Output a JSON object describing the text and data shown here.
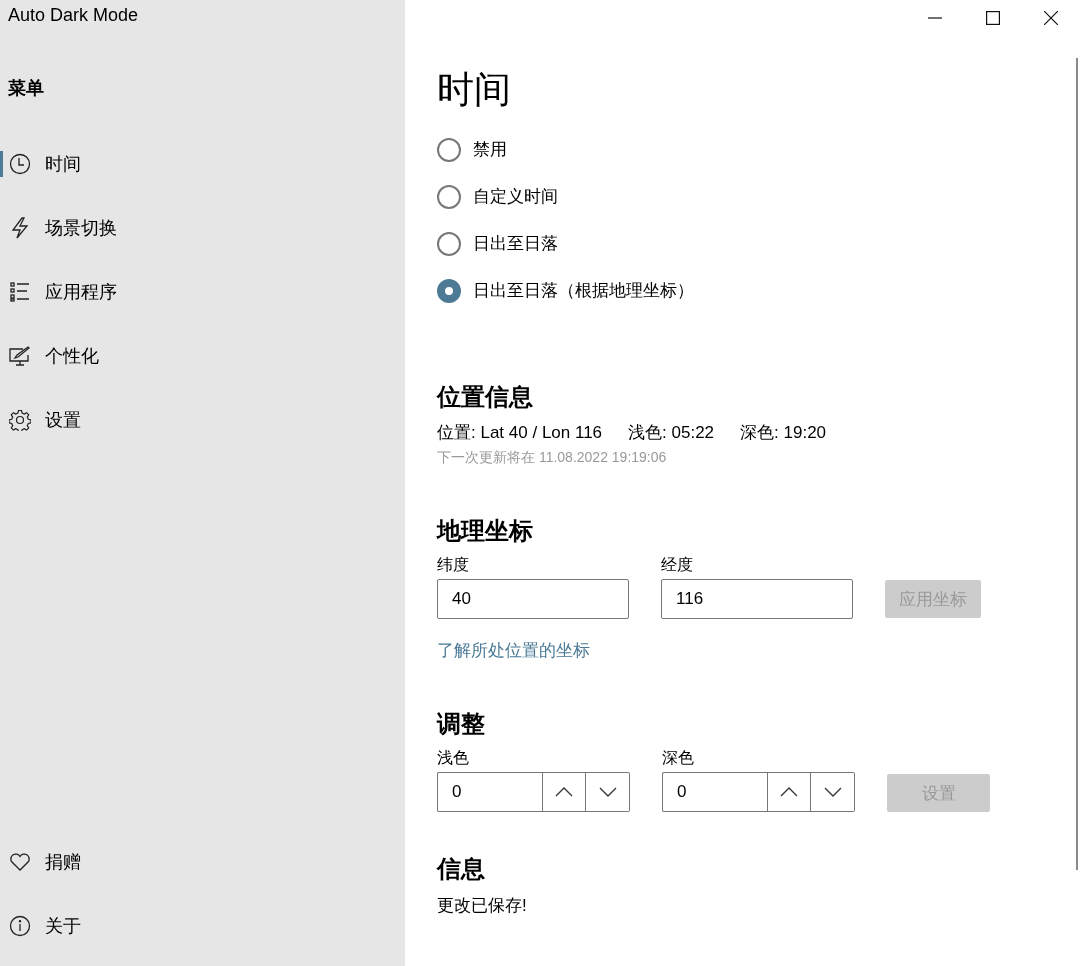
{
  "window": {
    "title": "Auto Dark Mode"
  },
  "sidebar": {
    "heading": "菜单",
    "items": [
      {
        "label": "时间",
        "selected": true
      },
      {
        "label": "场景切换",
        "selected": false
      },
      {
        "label": "应用程序",
        "selected": false
      },
      {
        "label": "个性化",
        "selected": false
      },
      {
        "label": "设置",
        "selected": false
      }
    ],
    "footer_items": [
      {
        "label": "捐赠",
        "selected": false
      },
      {
        "label": "关于",
        "selected": false
      }
    ]
  },
  "page": {
    "title": "时间",
    "radios": [
      {
        "label": "禁用",
        "selected": false
      },
      {
        "label": "自定义时间",
        "selected": false
      },
      {
        "label": "日出至日落",
        "selected": false
      },
      {
        "label": "日出至日落（根据地理坐标）",
        "selected": true
      }
    ],
    "location": {
      "heading": "位置信息",
      "position": "位置: Lat 40 / Lon 116",
      "light": "浅色: 05:22",
      "dark": "深色: 19:20",
      "next_update": "下一次更新将在 11.08.2022 19:19:06"
    },
    "coordinates": {
      "heading": "地理坐标",
      "fields": [
        {
          "label": "纬度",
          "value": "40"
        },
        {
          "label": "经度",
          "value": "116"
        }
      ],
      "button": {
        "label": "应用坐标",
        "disabled": true
      },
      "link": "了解所处位置的坐标"
    },
    "adjust": {
      "heading": "调整",
      "fields": [
        {
          "label": "浅色",
          "value": "0"
        },
        {
          "label": "深色",
          "value": "0"
        }
      ],
      "button": {
        "label": "设置",
        "disabled": true
      }
    },
    "info": {
      "heading": "信息",
      "message": "更改已保存!"
    }
  }
}
